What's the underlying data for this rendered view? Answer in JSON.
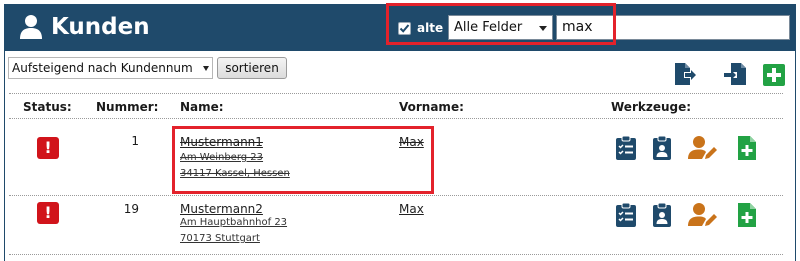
{
  "header": {
    "title": "Kunden",
    "icon": "user-icon"
  },
  "filter": {
    "alte_label": "alte",
    "alte_checked": true,
    "field_select_value": "Alle Felder",
    "search_value": "max"
  },
  "toolbar": {
    "sort_select_value": "Aufsteigend nach Kundennum",
    "sort_button_label": "sortieren",
    "buttons": [
      "export-icon",
      "import-icon",
      "add-icon"
    ]
  },
  "table": {
    "columns": {
      "status": "Status:",
      "nummer": "Nummer:",
      "name": "Name:",
      "vorname": "Vorname:",
      "werkzeuge": "Werkzeuge:"
    },
    "rows": [
      {
        "status": "!",
        "nummer": "1",
        "name": "Mustermann1",
        "strasse": "Am Weinberg 23",
        "ort": "34117 Kassel, Hessen",
        "vorname": "Max",
        "archived": true
      },
      {
        "status": "!",
        "nummer": "19",
        "name": "Mustermann2",
        "strasse": "Am Hauptbahnhof 23",
        "ort": "70173 Stuttgart",
        "vorname": "Max",
        "archived": false
      }
    ],
    "tools": [
      "clipboard-list-icon",
      "clipboard-user-icon",
      "user-edit-icon",
      "file-add-icon"
    ]
  },
  "colors": {
    "header_bg": "#1f4a6b",
    "icon_blue": "#1f4a6b",
    "status_red": "#d1141b",
    "edit_orange": "#c9731a",
    "add_green": "#22a244",
    "highlight_red": "#e3222b"
  }
}
